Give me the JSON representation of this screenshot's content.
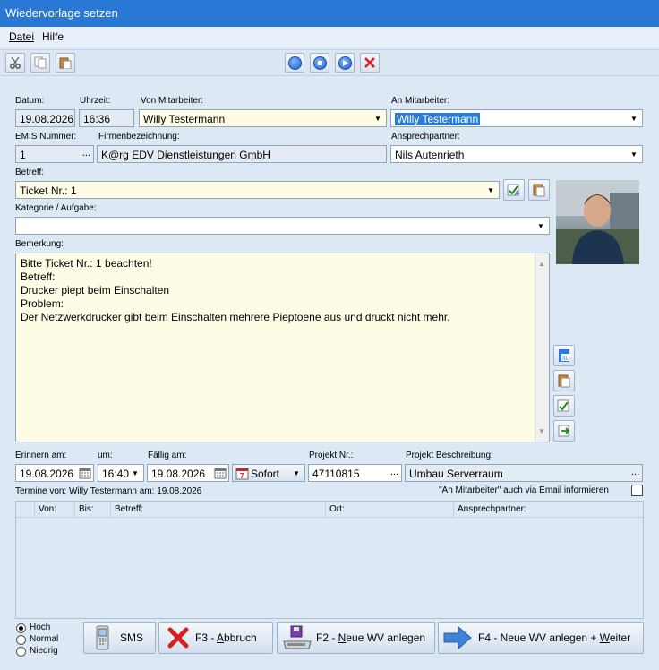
{
  "window": {
    "title": "Wiedervorlage setzen"
  },
  "menu": {
    "items": [
      "Datei",
      "Hilfe"
    ]
  },
  "form": {
    "datum_label": "Datum:",
    "datum": "19.08.2026",
    "uhrzeit_label": "Uhrzeit:",
    "uhrzeit": "16:36",
    "von_label": "Von Mitarbeiter:",
    "von": "Willy Testermann",
    "an_label": "An Mitarbeiter:",
    "an": "Willy Testermann",
    "emis_label": "EMIS Nummer:",
    "emis": "1",
    "firma_label": "Firmenbezeichnung:",
    "firma": "K@rg EDV Dienstleistungen GmbH",
    "ansprech_label": "Ansprechpartner:",
    "ansprech": "Nils Autenrieth",
    "betreff_label": "Betreff:",
    "betreff": "Ticket Nr.: 1",
    "kategorie_label": "Kategorie / Aufgabe:",
    "kategorie": "",
    "bemerkung_label": "Bemerkung:",
    "bemerkung_lines": [
      "Bitte Ticket Nr.: 1 beachten!",
      "",
      "Betreff:",
      "Drucker piept beim Einschalten",
      "",
      "Problem:",
      "Der Netzwerkdrucker gibt beim Einschalten mehrere Pieptoene aus und druckt nicht mehr."
    ],
    "erinnern_label": "Erinnern am:",
    "erinnern": "19.08.2026",
    "um_label": "um:",
    "um": "16:40",
    "faellig_label": "Fällig am:",
    "faellig": "19.08.2026",
    "sofort": "Sofort",
    "projekt_nr_label": "Projekt Nr.:",
    "projekt_nr": "47110815",
    "projekt_beschr_label": "Projekt Beschreibung:",
    "projekt_beschr": "Umbau Serverraum",
    "termine_label": "Termine von: Willy Testermann am: 19.08.2026",
    "email_info": "\"An Mitarbeiter\" auch via Email informieren"
  },
  "grid": {
    "columns": [
      "Von:",
      "Bis:",
      "Betreff:",
      "Ort:",
      "Ansprechpartner:"
    ]
  },
  "priority": {
    "options": [
      "Hoch",
      "Normal",
      "Niedrig"
    ],
    "selected": "Hoch"
  },
  "buttons": {
    "sms": "SMS",
    "abbruch_prefix": "F3 - ",
    "abbruch_u": "A",
    "abbruch_rest": "bbruch",
    "neu_prefix": "F2 - ",
    "neu_u": "N",
    "neu_rest": "eue WV anlegen",
    "weiter_prefix": "F4 - Neue WV anlegen + ",
    "weiter_u": "W",
    "weiter_rest": "eiter"
  },
  "ellipsis": "..."
}
